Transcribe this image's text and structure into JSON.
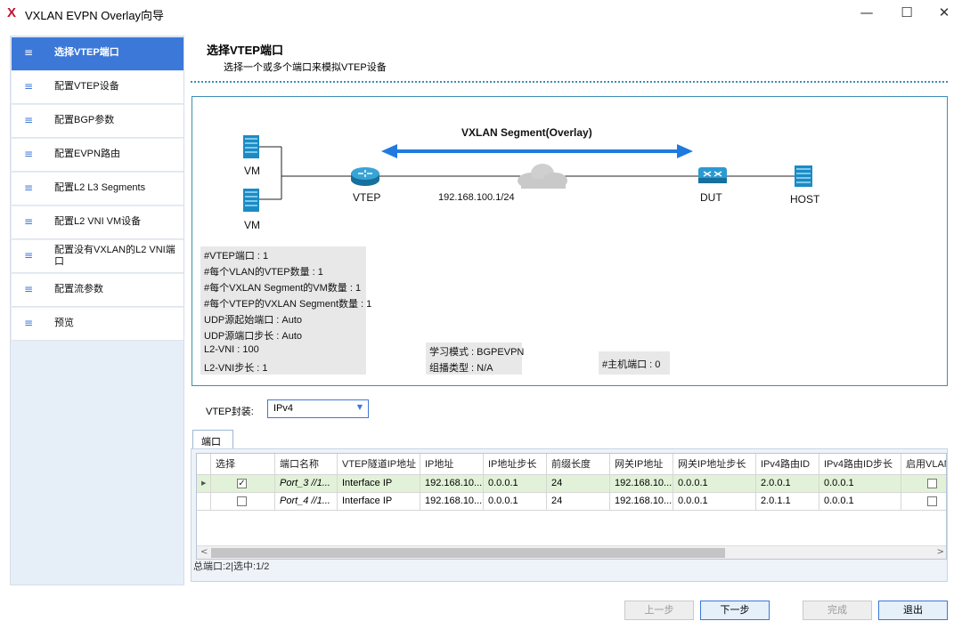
{
  "window": {
    "logo": "X",
    "title": "VXLAN EVPN Overlay向导",
    "minimize_glyph": "—",
    "maximize_glyph": "☐",
    "close_glyph": "✕"
  },
  "sidebar": {
    "icon_glyph": "≡",
    "items": [
      {
        "label": "选择VTEP端口",
        "active": true
      },
      {
        "label": "配置VTEP设备"
      },
      {
        "label": "配置BGP参数"
      },
      {
        "label": "配置EVPN路由"
      },
      {
        "label": "配置L2 L3 Segments"
      },
      {
        "label": "配置L2 VNI VM设备"
      },
      {
        "label": "配置没有VXLAN的L2 VNI端口"
      },
      {
        "label": "配置流参数"
      },
      {
        "label": "预览"
      }
    ]
  },
  "main": {
    "title": "选择VTEP端口",
    "subtitle": "选择一个或多个端口来模拟VTEP设备"
  },
  "diagram": {
    "segment_label": "VXLAN Segment(Overlay)",
    "vm1": "VM",
    "vm2": "VM",
    "vtep": "VTEP",
    "ip": "192.168.100.1/24",
    "dut": "DUT",
    "host": "HOST",
    "info": [
      "#VTEP端口 : 1",
      "#每个VLAN的VTEP数量 : 1",
      "#每个VXLAN Segment的VM数量 : 1",
      "#每个VTEP的VXLAN Segment数量 : 1",
      "UDP源起始端口 : Auto",
      "UDP源端口步长 : Auto",
      "L2-VNI : 100",
      "L2-VNI步长 : 1"
    ],
    "learn_mode": "学习模式 : BGPEVPN",
    "multicast_type": "组播类型 : N/A",
    "host_ports": "#主机端口 : 0",
    "colors": {
      "border": "#3a8fb7",
      "arrow": "#1f7ae0",
      "device": "#1c8bc4"
    }
  },
  "encap": {
    "label": "VTEP封装:",
    "value": "IPv4"
  },
  "ports": {
    "tab_label": "端口",
    "columns": [
      "选择",
      "端口名称",
      "VTEP隧道IP地址",
      "IP地址",
      "IP地址步长",
      "前缀长度",
      "网关IP地址",
      "网关IP地址步长",
      "IPv4路由ID",
      "IPv4路由ID步长",
      "启用VLAN"
    ],
    "rows": [
      {
        "selected": true,
        "name": "Port_3 //1...",
        "vtep_ip": "Interface IP",
        "ip": "192.168.10...",
        "ip_step": "0.0.0.1",
        "prefix": "24",
        "gateway": "192.168.10...",
        "gateway_step": "0.0.0.1",
        "router_id": "2.0.0.1",
        "router_id_step": "0.0.0.1",
        "vlan": false
      },
      {
        "selected": false,
        "name": "Port_4 //1...",
        "vtep_ip": "Interface IP",
        "ip": "192.168.10...",
        "ip_step": "0.0.0.1",
        "prefix": "24",
        "gateway": "192.168.10...",
        "gateway_step": "0.0.0.1",
        "router_id": "2.0.1.1",
        "router_id_step": "0.0.0.1",
        "vlan": false
      }
    ],
    "summary": "总端口:2|选中:1/2",
    "scroll_left": "<",
    "scroll_right": ">"
  },
  "footer": {
    "prev": "上一步",
    "next": "下一步",
    "finish": "完成",
    "exit": "退出"
  }
}
